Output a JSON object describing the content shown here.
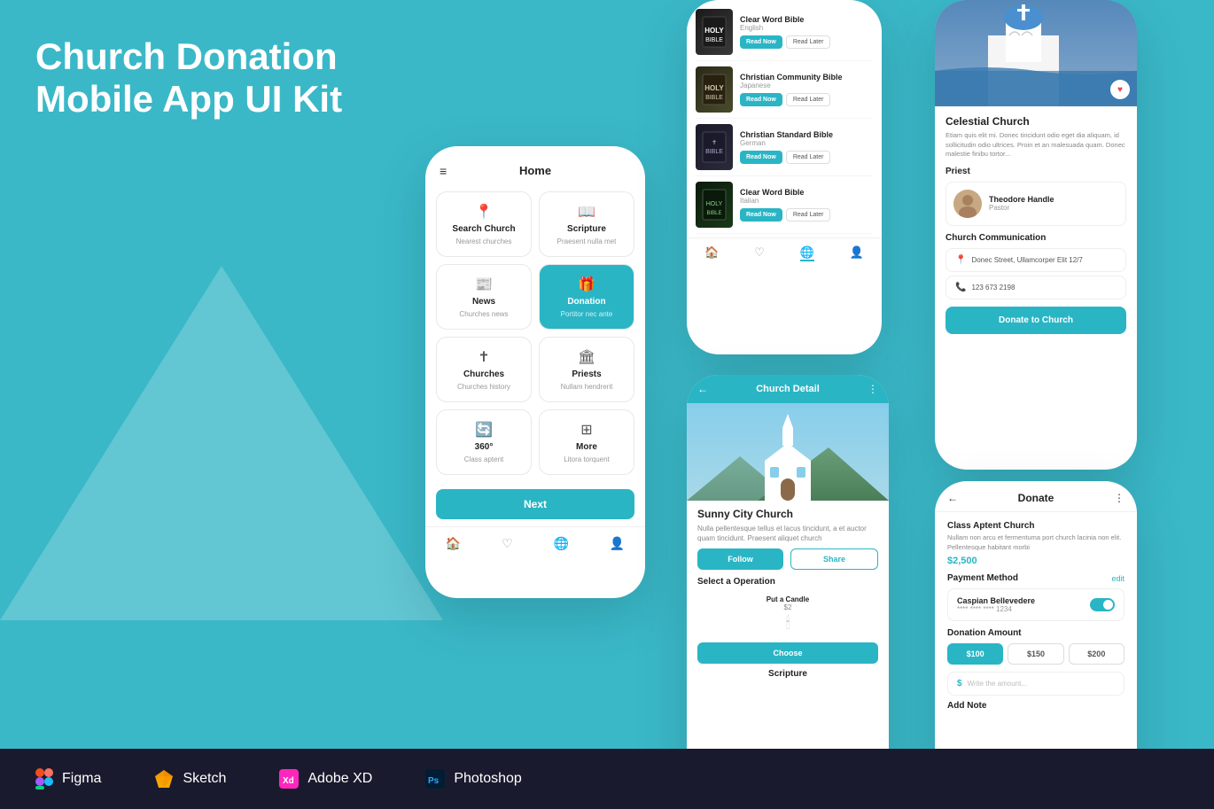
{
  "title": {
    "line1": "Church Donation",
    "line2": "Mobile App UI Kit"
  },
  "phone1": {
    "header": "Home",
    "grid": [
      {
        "label": "Search Church",
        "sublabel": "Nearest churches",
        "icon": "📍",
        "active": false
      },
      {
        "label": "Scripture",
        "sublabel": "Praesent nulla met",
        "icon": "📖",
        "active": false
      },
      {
        "label": "News",
        "sublabel": "Churches news",
        "icon": "📰",
        "active": false
      },
      {
        "label": "Donation",
        "sublabel": "Portitor nec ante",
        "icon": "🎁",
        "active": true
      },
      {
        "label": "Churches",
        "sublabel": "Churches history",
        "icon": "✝",
        "active": false
      },
      {
        "label": "Priests",
        "sublabel": "Nullam hendrerit",
        "icon": "🏛",
        "active": false
      },
      {
        "label": "360°",
        "sublabel": "Class aptent",
        "icon": "🔄",
        "active": false
      },
      {
        "label": "More",
        "sublabel": "Litora torquent",
        "icon": "⊞",
        "active": false
      }
    ],
    "next_button": "Next"
  },
  "phone2": {
    "bibles": [
      {
        "title": "Clear Word Bible",
        "lang": "English",
        "btn1": "Read Now",
        "btn2": "Read Later"
      },
      {
        "title": "Christian Community Bible",
        "lang": "Japanese",
        "btn1": "Read Now",
        "btn2": "Read Later"
      },
      {
        "title": "Christian Standard Bible",
        "lang": "German",
        "btn1": "Read Now",
        "btn2": "Read Later"
      },
      {
        "title": "Clear Word Bible",
        "lang": "Italian",
        "btn1": "Read Now",
        "btn2": "Read Later"
      }
    ]
  },
  "phone3": {
    "header": "Church Detail",
    "church_name": "Sunny City Church",
    "church_desc": "Nulla pellentesque tellus et lacus tincidunt, a et auctor quam tincidunt. Praesent aliquet church",
    "btn_follow": "Follow",
    "btn_share": "Share",
    "select_operation": "Select a Operation",
    "candle_title": "Put a Candle",
    "candle_price": "$2",
    "btn_choose": "Choose",
    "scripture_label": "Scripture"
  },
  "phone4": {
    "church_name": "Celestial Church",
    "church_desc": "Etiam quis elit mi. Donec tincidunt odio eget dia aliquam, id sollicitudin odio ultrices. Proin et an malesuada quam. Donec malestie finibu tortor...",
    "priest_section": "Priest",
    "priest_name": "Theodore Handle",
    "priest_role": "Pastor",
    "comm_section": "Church Communication",
    "address": "Donec Street, Ullamcorper Elit 12/7",
    "phone": "123 673 2198",
    "donate_btn": "Donate to Church"
  },
  "phone5": {
    "header": "Donate",
    "church_name": "Class Aptent Church",
    "church_desc": "Nullam non arcu et fermentuma port church lacinia non elit. Pellentesque habitant morbi",
    "amount": "$2,500",
    "payment_label": "Payment Method",
    "payment_edit": "edit",
    "card_name": "Caspian Bellevedere",
    "card_num": "**** **** **** 1234",
    "donation_amount_label": "Donation Amount",
    "amounts": [
      "$100",
      "$150",
      "$200"
    ],
    "active_amount": 0,
    "placeholder": "Write the amount...",
    "add_note": "Add Note"
  },
  "toolbar": {
    "tools": [
      {
        "icon": "figma",
        "label": "Figma"
      },
      {
        "icon": "sketch",
        "label": "Sketch"
      },
      {
        "icon": "xd",
        "label": "Adobe XD"
      },
      {
        "icon": "ps",
        "label": "Photoshop"
      }
    ]
  }
}
